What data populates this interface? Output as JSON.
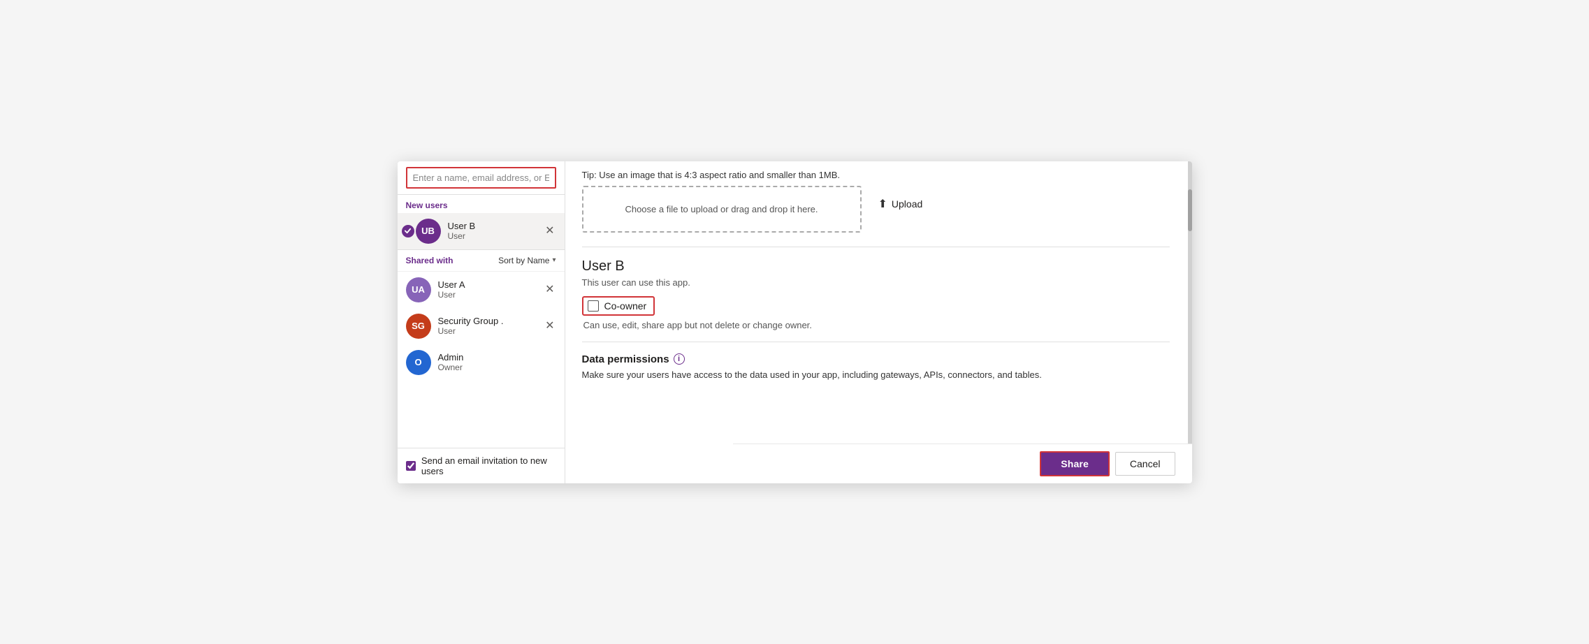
{
  "left": {
    "search_placeholder": "Enter a name, email address, or Everyone",
    "new_users_label": "New users",
    "new_users": [
      {
        "initials": "UB",
        "name": "User B",
        "role": "User",
        "color": "purple",
        "selected": true
      }
    ],
    "shared_with_label": "Shared with",
    "sort_label": "Sort by Name",
    "shared_users": [
      {
        "initials": "UA",
        "name": "User A",
        "role": "User",
        "color": "purple-light"
      },
      {
        "initials": "SG",
        "name": "Security Group .",
        "role": "User",
        "color": "red"
      },
      {
        "initials": "O",
        "name": "Admin",
        "role": "Owner",
        "color": "blue"
      }
    ],
    "email_checkbox_label": "Send an email invitation to new users",
    "email_checked": true
  },
  "right": {
    "tip_text": "Tip: Use an image that is 4:3 aspect ratio and smaller than 1MB.",
    "drop_zone_text": "Choose a file to upload or drag and drop it here.",
    "upload_label": "Upload",
    "user_b_name": "User B",
    "user_b_desc": "This user can use this app.",
    "coowner_label": "Co-owner",
    "coowner_note": "Can use, edit, share app but not delete or change owner.",
    "data_permissions_title": "Data permissions",
    "data_permissions_desc": "Make sure your users have access to the data used in your app, including gateways, APIs, connectors, and tables.",
    "share_label": "Share",
    "cancel_label": "Cancel"
  }
}
